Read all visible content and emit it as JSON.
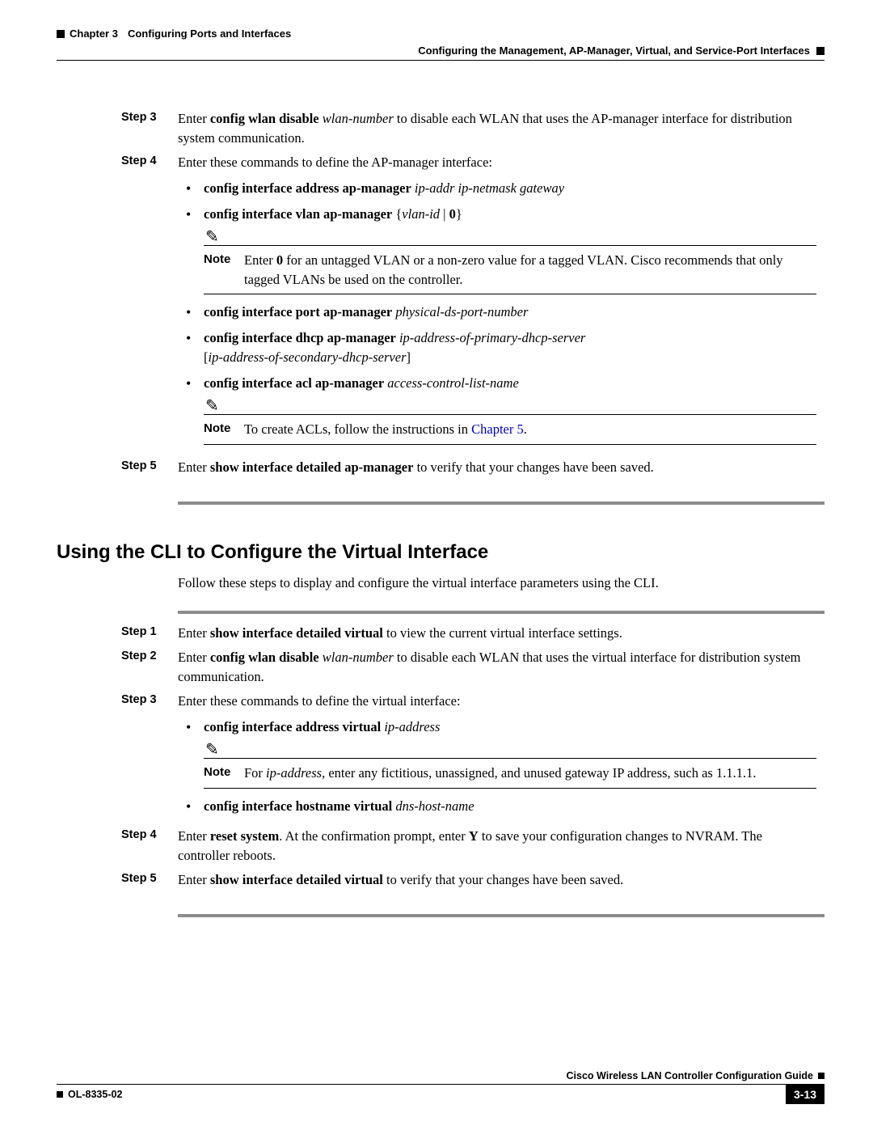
{
  "header": {
    "chapter": "Chapter 3",
    "chapter_title": "Configuring Ports and Interfaces",
    "section_title": "Configuring the Management, AP-Manager, Virtual, and Service-Port Interfaces"
  },
  "section1": {
    "step3": {
      "label": "Step 3",
      "prefix": "Enter ",
      "cmd": "config wlan disable",
      "arg": "wlan-number",
      "suffix": " to disable each WLAN that uses the AP-manager interface for distribution system communication."
    },
    "step4": {
      "label": "Step 4",
      "intro": "Enter these commands to define the AP-manager interface:",
      "bullets": {
        "b1": {
          "cmd": "config interface address ap-manager",
          "args": "ip-addr ip-netmask gateway"
        },
        "b2": {
          "cmd": "config interface vlan ap-manager",
          "brace_open": "{",
          "arg": "vlan-id",
          "pipe": " | ",
          "zero": "0",
          "brace_close": "}"
        },
        "b3": {
          "cmd": "config interface port ap-manager",
          "args": "physical-ds-port-number"
        },
        "b4": {
          "cmd": "config interface dhcp ap-manager",
          "arg1": "ip-address-of-primary-dhcp-server",
          "bracket_open": "[",
          "arg2": "ip-address-of-secondary-dhcp-server",
          "bracket_close": "]"
        },
        "b5": {
          "cmd": "config interface acl ap-manager",
          "args": "access-control-list-name"
        }
      },
      "note1": {
        "label": "Note",
        "pre": "Enter ",
        "bold": "0",
        "post": " for an untagged VLAN or a non-zero value for a tagged VLAN. Cisco recommends that only tagged VLANs be used on the controller."
      },
      "note2": {
        "label": "Note",
        "pre": "To create ACLs, follow the instructions in ",
        "link": "Chapter 5",
        "post": "."
      }
    },
    "step5": {
      "label": "Step 5",
      "pre": "Enter ",
      "cmd": "show interface detailed ap-manager",
      "post": " to verify that your changes have been saved."
    }
  },
  "section2": {
    "heading": "Using the CLI to Configure the Virtual Interface",
    "intro": "Follow these steps to display and configure the virtual interface parameters using the CLI.",
    "step1": {
      "label": "Step 1",
      "pre": "Enter ",
      "cmd": "show interface detailed virtual",
      "post": " to view the current virtual interface settings."
    },
    "step2": {
      "label": "Step 2",
      "pre": "Enter ",
      "cmd": "config wlan disable",
      "arg": "wlan-number",
      "post": " to disable each WLAN that uses the virtual interface for distribution system communication."
    },
    "step3": {
      "label": "Step 3",
      "intro": "Enter these commands to define the virtual interface:",
      "bullets": {
        "b1": {
          "cmd": "config interface address virtual",
          "args": "ip-address"
        },
        "b2": {
          "cmd": "config interface hostname virtual",
          "args": "dns-host-name"
        }
      },
      "note1": {
        "label": "Note",
        "pre": "For ",
        "ital": "ip-address",
        "post": ", enter any fictitious, unassigned, and unused gateway IP address, such as 1.1.1.1."
      }
    },
    "step4": {
      "label": "Step 4",
      "pre": "Enter ",
      "cmd": "reset system",
      "mid": ". At the confirmation prompt, enter ",
      "y": "Y",
      "post": " to save your configuration changes to NVRAM. The controller reboots."
    },
    "step5": {
      "label": "Step 5",
      "pre": "Enter ",
      "cmd": "show interface detailed virtual",
      "post": " to verify that your changes have been saved."
    }
  },
  "footer": {
    "guide": "Cisco Wireless LAN Controller Configuration Guide",
    "docnum": "OL-8335-02",
    "page": "3-13"
  }
}
